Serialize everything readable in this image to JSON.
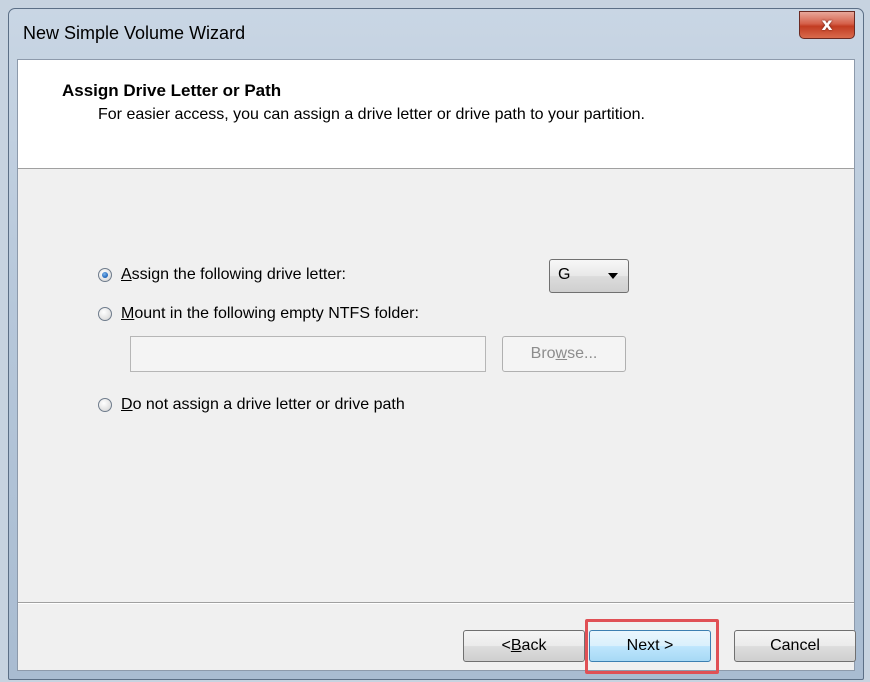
{
  "window": {
    "title": "New Simple Volume Wizard",
    "close_glyph": "x"
  },
  "header": {
    "title": "Assign Drive Letter or Path",
    "subtitle": "For easier access, you can assign a drive letter or drive path to your partition."
  },
  "options": {
    "assign_letter": {
      "mnemonic": "A",
      "label_rest": "ssign the following drive letter:",
      "selected": true
    },
    "mount_folder": {
      "mnemonic": "M",
      "label_rest": "ount in the following empty NTFS folder:",
      "selected": false,
      "folder_value": "",
      "browse_mnemonic": "w",
      "browse_pre": "Bro",
      "browse_post": "se...",
      "browse_enabled": false
    },
    "no_letter": {
      "mnemonic": "D",
      "label_rest": "o not assign a drive letter or drive path",
      "selected": false
    }
  },
  "drive_letter": {
    "selected": "G"
  },
  "buttons": {
    "back_pre": "< ",
    "back_mnemonic": "B",
    "back_post": "ack",
    "next": "Next >",
    "cancel": "Cancel"
  },
  "colors": {
    "highlight": "#e05055",
    "close_button": "#c23c22",
    "radio_selected": "#2a6fc2"
  },
  "icons": {
    "close": "close-icon",
    "dropdown": "chevron-down-icon"
  }
}
